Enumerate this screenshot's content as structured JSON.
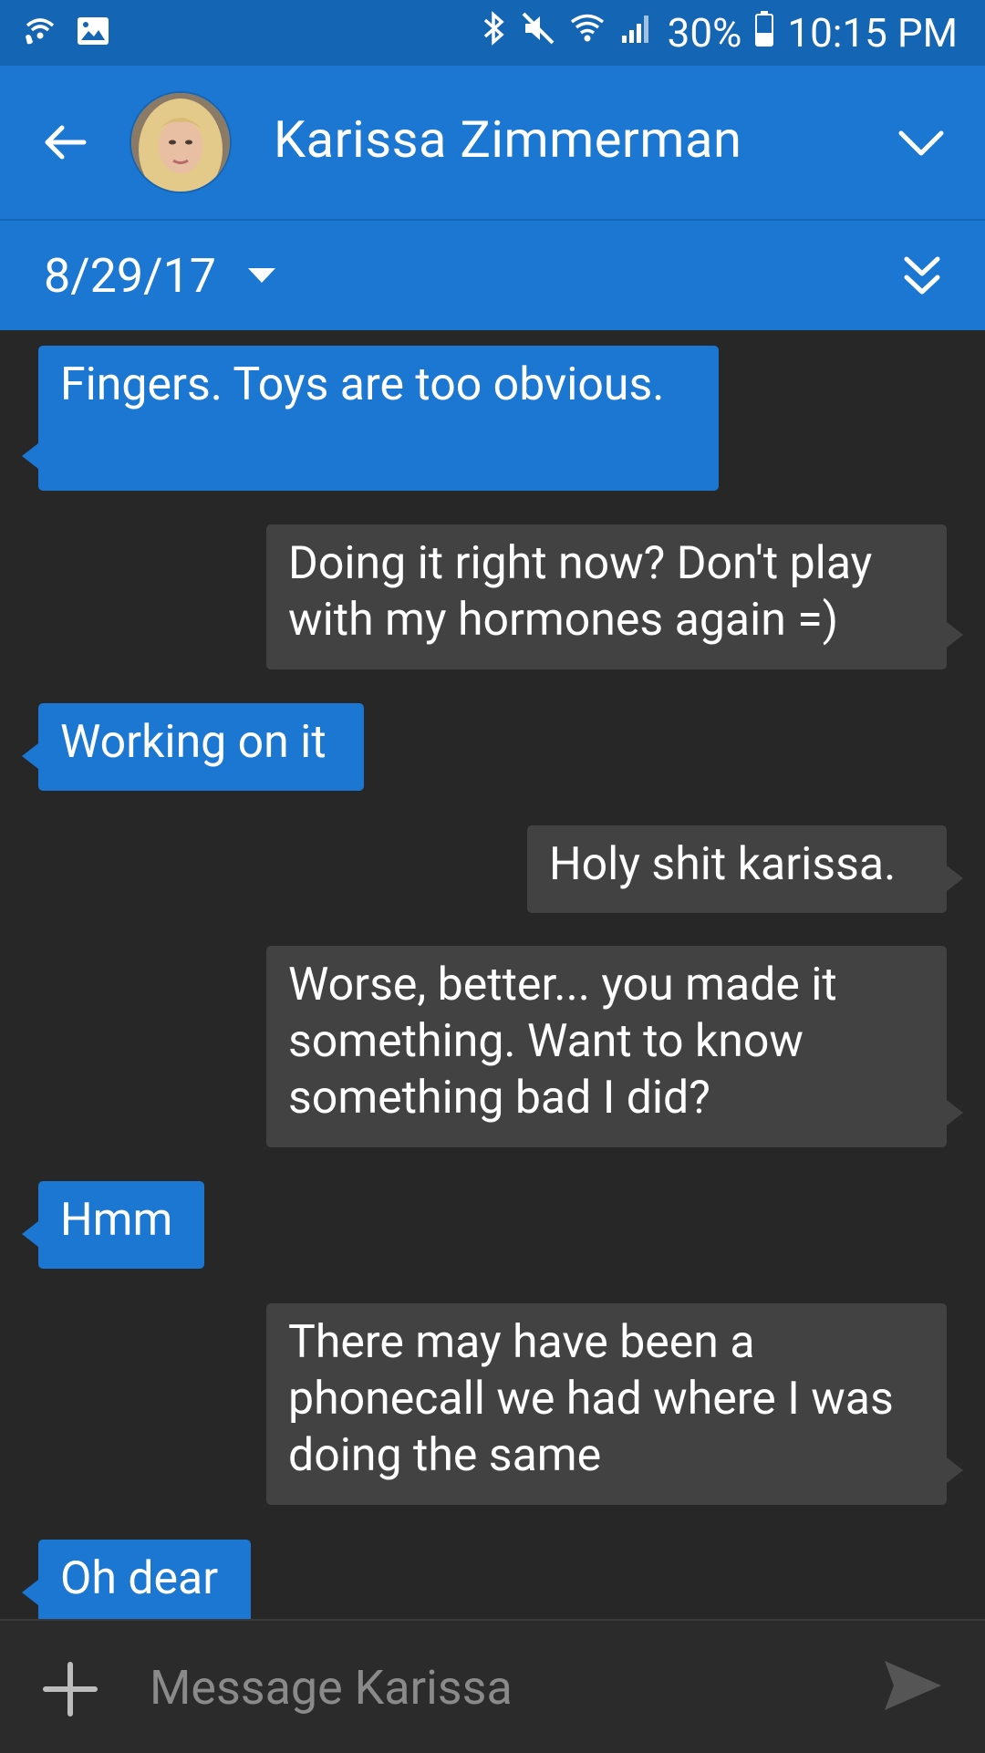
{
  "status_bar": {
    "battery": "30%",
    "time": "10:15 PM",
    "icons": [
      "wifi-calling-icon",
      "image-icon",
      "bluetooth-icon",
      "mute-icon",
      "wifi-icon",
      "signal-icon",
      "battery-icon"
    ]
  },
  "app_bar": {
    "contact_name": "Karissa Zimmerman",
    "back_icon": "arrow-left-icon",
    "expand_icon": "chevron-down-icon"
  },
  "date_bar": {
    "date": "8/29/17",
    "caret_icon": "caret-down-icon",
    "jump_icon": "double-chevron-down-icon"
  },
  "messages": [
    {
      "direction": "in",
      "text": "Fingers. Toys are too obvious."
    },
    {
      "direction": "out",
      "text": "Doing it right now? Don't play with my hormones again =)"
    },
    {
      "direction": "in",
      "text": "Working on it"
    },
    {
      "direction": "out",
      "text": "Holy shit karissa."
    },
    {
      "direction": "out",
      "text": "Worse, better... you made it something. Want to know something bad I did?"
    },
    {
      "direction": "in",
      "text": "Hmm"
    },
    {
      "direction": "out",
      "text": "There may have been a phonecall we had where I was doing the same"
    },
    {
      "direction": "in",
      "text": "Oh dear"
    }
  ],
  "composer": {
    "placeholder": "Message Karissa",
    "value": "",
    "attach_icon": "plus-icon",
    "send_icon": "send-icon"
  },
  "colors": {
    "status_bar": "#1565b5",
    "app_bar": "#1b77d2",
    "background": "#272727",
    "incoming_bubble": "#1b77d2",
    "outgoing_bubble": "#424242"
  }
}
